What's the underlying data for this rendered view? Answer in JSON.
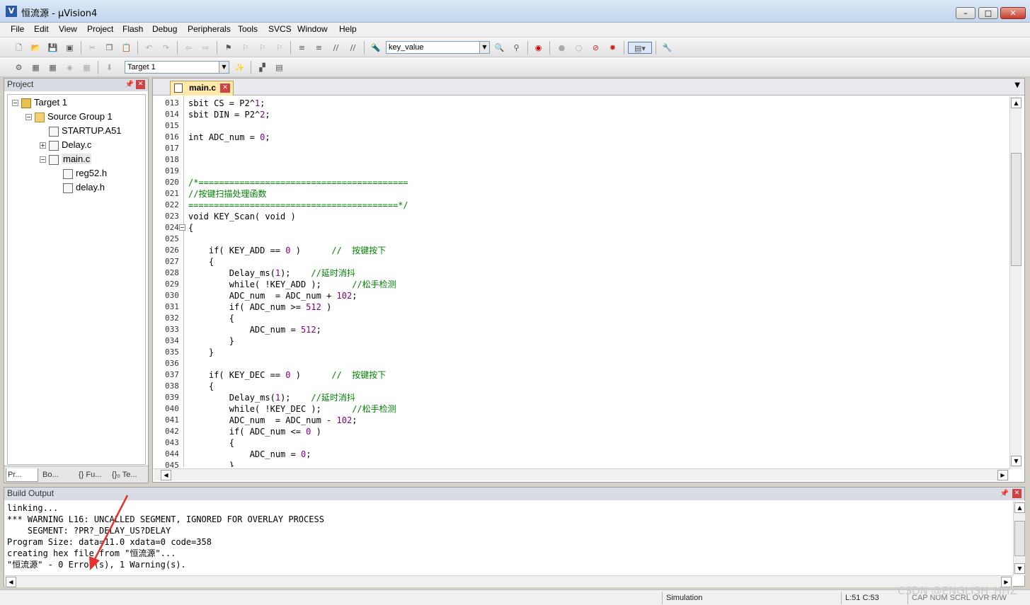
{
  "window": {
    "title": "恒流源 - µVision4",
    "app_icon": "V",
    "buttons": {
      "minimize": "–",
      "maximize": "□",
      "close": "✕"
    }
  },
  "menu": [
    "File",
    "Edit",
    "View",
    "Project",
    "Flash",
    "Debug",
    "Peripherals",
    "Tools",
    "SVCS",
    "Window",
    "Help"
  ],
  "toolbar1": {
    "find_combo_value": "key_value"
  },
  "toolbar2": {
    "target_combo_value": "Target 1"
  },
  "project_panel": {
    "title": "Project",
    "tree": [
      {
        "label": "Target 1",
        "expander": "−",
        "icon": "target"
      },
      {
        "label": "Source Group 1",
        "expander": "−",
        "icon": "folder"
      },
      {
        "label": "STARTUP.A51",
        "expander": "",
        "icon": "file"
      },
      {
        "label": "Delay.c",
        "expander": "+",
        "icon": "file"
      },
      {
        "label": "main.c",
        "expander": "−",
        "icon": "file"
      },
      {
        "label": "reg52.h",
        "expander": "",
        "icon": "file"
      },
      {
        "label": "delay.h",
        "expander": "",
        "icon": "file"
      }
    ],
    "tabs": [
      "Pr...",
      "Bo...",
      "{} Fu...",
      "{}₀ Te..."
    ]
  },
  "editor": {
    "tab_label": "main.c",
    "lines": [
      {
        "n": "013",
        "code": "sbit CS = P2^1;"
      },
      {
        "n": "014",
        "code": "sbit DIN = P2^2;"
      },
      {
        "n": "015",
        "code": ""
      },
      {
        "n": "016",
        "code": "int ADC_num = 0;"
      },
      {
        "n": "017",
        "code": ""
      },
      {
        "n": "018",
        "code": ""
      },
      {
        "n": "019",
        "code": ""
      },
      {
        "n": "020",
        "code": "/*========================================="
      },
      {
        "n": "021",
        "code": "//按键扫描处理函数"
      },
      {
        "n": "022",
        "code": "=========================================*/"
      },
      {
        "n": "023",
        "code": "void KEY_Scan( void )"
      },
      {
        "n": "024",
        "code": "{"
      },
      {
        "n": "025",
        "code": ""
      },
      {
        "n": "026",
        "code": "    if( KEY_ADD == 0 )      //  按键按下"
      },
      {
        "n": "027",
        "code": "    {"
      },
      {
        "n": "028",
        "code": "        Delay_ms(1);    //延时消抖"
      },
      {
        "n": "029",
        "code": "        while( !KEY_ADD );      //松手检测"
      },
      {
        "n": "030",
        "code": "        ADC_num  = ADC_num + 102;"
      },
      {
        "n": "031",
        "code": "        if( ADC_num >= 512 )"
      },
      {
        "n": "032",
        "code": "        {"
      },
      {
        "n": "033",
        "code": "            ADC_num = 512;"
      },
      {
        "n": "034",
        "code": "        }"
      },
      {
        "n": "035",
        "code": "    }"
      },
      {
        "n": "036",
        "code": ""
      },
      {
        "n": "037",
        "code": "    if( KEY_DEC == 0 )      //  按键按下"
      },
      {
        "n": "038",
        "code": "    {"
      },
      {
        "n": "039",
        "code": "        Delay_ms(1);    //延时消抖"
      },
      {
        "n": "040",
        "code": "        while( !KEY_DEC );      //松手检测"
      },
      {
        "n": "041",
        "code": "        ADC_num  = ADC_num - 102;"
      },
      {
        "n": "042",
        "code": "        if( ADC_num <= 0 )"
      },
      {
        "n": "043",
        "code": "        {"
      },
      {
        "n": "044",
        "code": "            ADC_num = 0;"
      },
      {
        "n": "045",
        "code": "        }"
      }
    ]
  },
  "build_output": {
    "title": "Build Output",
    "lines": [
      "linking...",
      "*** WARNING L16: UNCALLED SEGMENT, IGNORED FOR OVERLAY PROCESS",
      "    SEGMENT: ?PR?_DELAY_US?DELAY",
      "Program Size: data=11.0 xdata=0 code=358",
      "creating hex file from \"恒流源\"...",
      "\"恒流源\" - 0 Error(s), 1 Warning(s)."
    ]
  },
  "statusbar": {
    "mode": "Simulation",
    "cursor": "L:51 C:53",
    "flags": "CAP  NUM  SCRL  OVR  R/W"
  },
  "watermark": "CSDN @ENGLISH_HHZ",
  "colors": {
    "comment": "#008000",
    "number": "#800080",
    "annotation_arrow": "#e53030"
  }
}
